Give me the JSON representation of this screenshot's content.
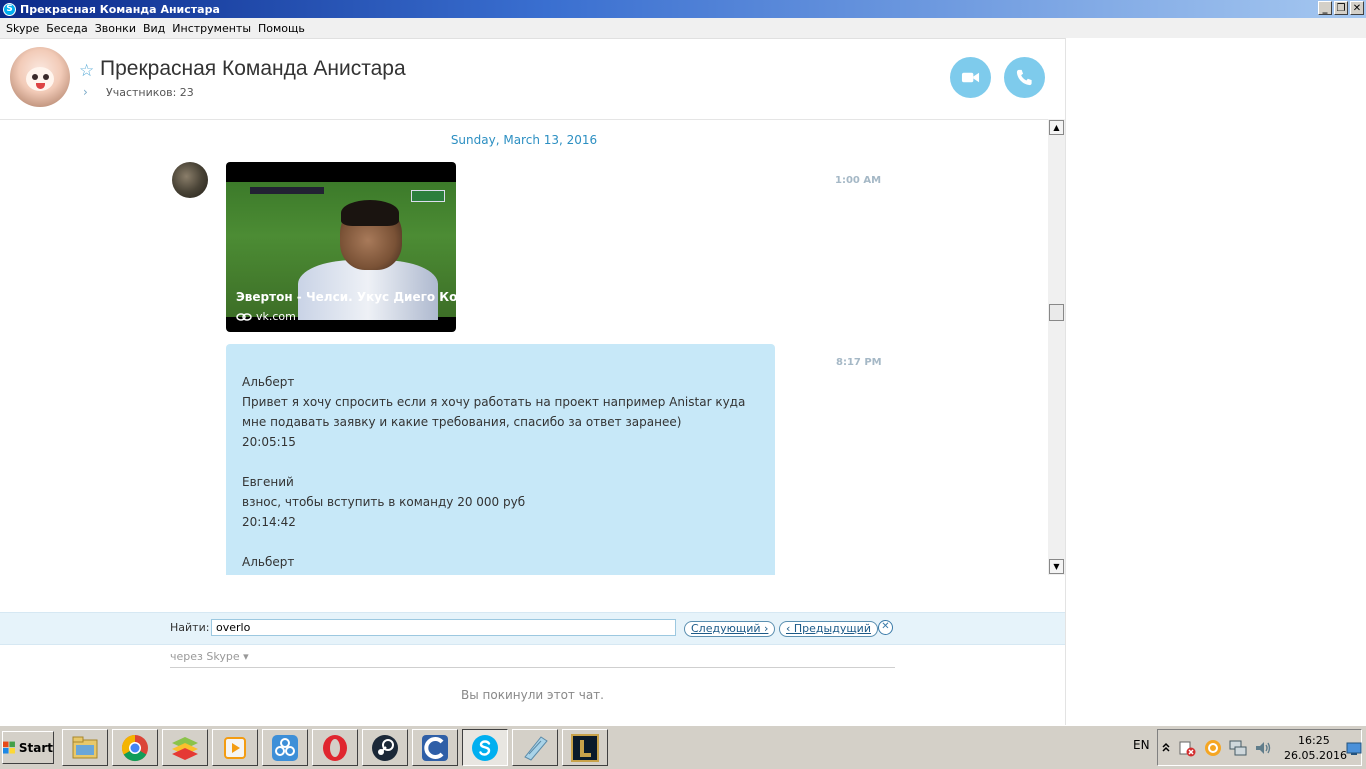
{
  "window": {
    "title": "Прекрасная Команда Анистара",
    "controls": [
      "_",
      "❐",
      "✕"
    ]
  },
  "menu": [
    "Skype",
    "Беседа",
    "Звонки",
    "Вид",
    "Инструменты",
    "Помощь"
  ],
  "header": {
    "title": "Прекрасная Команда Анистара",
    "participants": "Участников: 23",
    "star": "☆",
    "chevron": "›",
    "icons": [
      "star-icon",
      "video-call-icon",
      "audio-call-icon"
    ]
  },
  "chat": {
    "date_separator": "Sunday, March 13, 2016",
    "messages": [
      {
        "type": "video-link",
        "time": "1:00 AM",
        "caption": "Эвертон - Челси. Укус Диего Ко...",
        "source": "vk.com"
      },
      {
        "type": "text",
        "time": "8:17 PM",
        "lines": [
          "Альберт",
          "Привет я хочу спросить если я хочу работать на проект например Anistar куда",
          "мне подавать заявку и какие требования, спасибо за ответ заранее)",
          "20:05:15",
          "",
          "Евгений",
          "взнос, чтобы вступить в команду 20 000 руб",
          "20:14:42",
          "",
          "Альберт"
        ]
      }
    ]
  },
  "find": {
    "label": "Найти:",
    "value": "overlo",
    "next": "Следующий ›",
    "prev": "‹ Предыдущий",
    "close": "✕"
  },
  "compose": {
    "via": "через Skype ▾",
    "left_notice": "Вы покинули этот чат."
  },
  "taskbar": {
    "start": "Start",
    "apps": [
      "file-manager-icon",
      "chrome-icon",
      "bluestacks-icon",
      "media-player-icon",
      "network-app-icon",
      "opera-icon",
      "steam-icon",
      "ccleaner-icon",
      "skype-icon",
      "notepad-icon",
      "league-of-legends-icon"
    ],
    "lang": "EN",
    "time": "16:25",
    "date": "26.05.2016"
  },
  "colors": {
    "skype_blue": "#00aff0",
    "call_button": "#7ecbec",
    "bubble": "#c7e8f8",
    "date_text": "#2c8fc2"
  }
}
